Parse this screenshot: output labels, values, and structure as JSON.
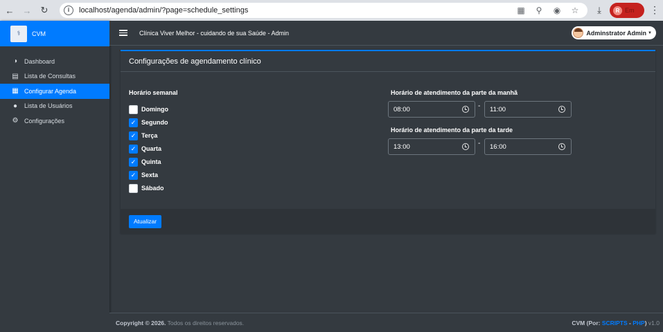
{
  "browser": {
    "url": "localhost/agenda/admin/?page=schedule_settings",
    "profile_initial": "R",
    "profile_label": "Em"
  },
  "brand": {
    "name": "CVM",
    "logo_text": "⚕"
  },
  "sidebar": {
    "items": [
      {
        "label": "Dashboard",
        "icon": "◑"
      },
      {
        "label": "Lista de Consultas",
        "icon": "▤"
      },
      {
        "label": "Configurar Agenda",
        "icon": "▦"
      },
      {
        "label": "Lista de Usuários",
        "icon": "●"
      },
      {
        "label": "Configurações",
        "icon": "⚙"
      }
    ],
    "active_index": 2
  },
  "header": {
    "title": "Clínica Viver Melhor - cuidando de sua Saúde - Admin",
    "user": "Adminstrator Admin"
  },
  "card": {
    "title": "Configurações de agendamento clínico",
    "weekly_label": "Horário semanal",
    "days": [
      {
        "label": "Domingo",
        "checked": false
      },
      {
        "label": "Segundo",
        "checked": true
      },
      {
        "label": "Terça",
        "checked": true
      },
      {
        "label": "Quarta",
        "checked": true
      },
      {
        "label": "Quinta",
        "checked": true
      },
      {
        "label": "Sexta",
        "checked": true
      },
      {
        "label": "Sábado",
        "checked": false
      }
    ],
    "morning_label": "Horário de atendimento da parte da manhã",
    "morning_from": "08:00",
    "morning_to": "11:00",
    "afternoon_label": "Horário de atendimento da parte da tarde",
    "afternoon_from": "13:00",
    "afternoon_to": "16:00",
    "separator": "-",
    "update_button": "Atualizar"
  },
  "footer": {
    "copyright_strong": "Copyright © 2026.",
    "copyright_rest": " Todos os direitos reservados.",
    "credit_prefix": "CVM (Por: ",
    "credit_link1": "SCRIPTS",
    "credit_mid": " - ",
    "credit_link2": "PHP",
    "credit_suffix": ")",
    "version": " v1.0"
  },
  "colors": {
    "accent": "#007bff",
    "background": "#343a40"
  }
}
